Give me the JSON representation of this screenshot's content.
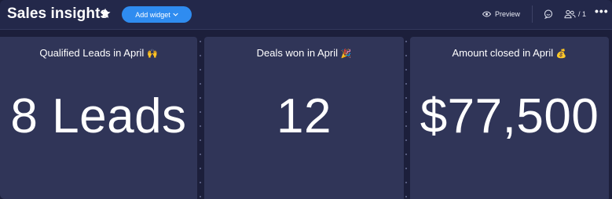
{
  "header": {
    "title": "Sales insights",
    "add_widget_label": "Add widget",
    "preview_label": "Preview",
    "members_count": "/ 1",
    "more_label": "•••"
  },
  "cards": [
    {
      "title": "Qualified Leads in April",
      "emoji": "🙌",
      "value": "8 Leads"
    },
    {
      "title": "Deals won in April",
      "emoji": "🎉",
      "value": "12"
    },
    {
      "title": "Amount closed in April",
      "emoji": "💰",
      "value": "$77,500"
    }
  ],
  "icons": [
    "star-icon",
    "chevron-down-icon",
    "eye-icon",
    "chat-icon",
    "people-icon",
    "more-icon"
  ],
  "colors": {
    "background": "#1c1f3b",
    "header": "#23284a",
    "card": "#303558",
    "accent": "#2f8cf0"
  }
}
